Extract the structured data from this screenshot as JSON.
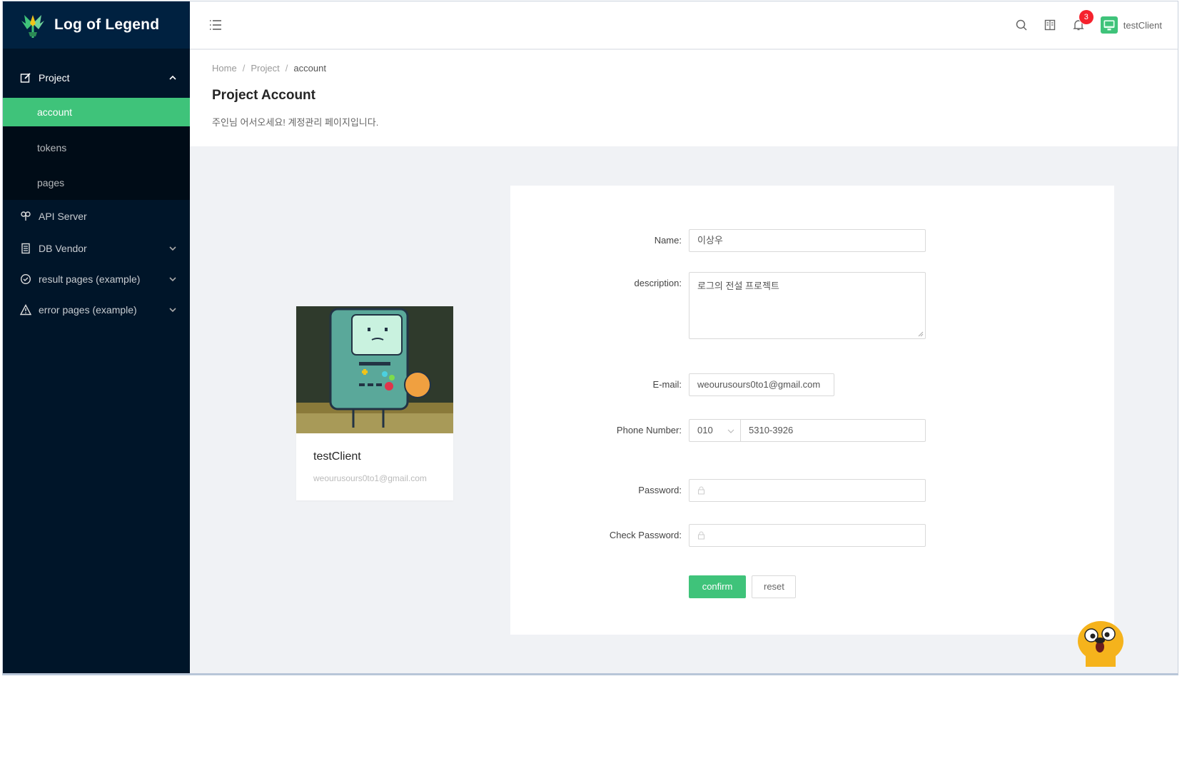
{
  "app": {
    "title": "Log of Legend",
    "accent_color": "#3fc37a",
    "sidebar_color": "#001529"
  },
  "sidebar": {
    "project": {
      "label": "Project",
      "icon": "edit-icon",
      "children": [
        {
          "label": "account",
          "active": true
        },
        {
          "label": "tokens"
        },
        {
          "label": "pages"
        }
      ]
    },
    "items": [
      {
        "label": "API Server",
        "icon": "api-icon"
      },
      {
        "label": "DB Vendor",
        "icon": "database-icon"
      },
      {
        "label": "result pages (example)",
        "icon": "check-circle-icon"
      },
      {
        "label": "error pages (example)",
        "icon": "warning-icon"
      }
    ]
  },
  "header": {
    "notification_count": "3",
    "username": "testClient"
  },
  "breadcrumb": {
    "home": "Home",
    "project": "Project",
    "current": "account",
    "separator": "/"
  },
  "page": {
    "title": "Project Account",
    "description": "주인님 어서오세요! 계정관리 페이지입니다."
  },
  "profile": {
    "name": "testClient",
    "email": "weourusours0to1@gmail.com"
  },
  "form": {
    "name": {
      "label": "Name",
      "value": "이상우"
    },
    "description": {
      "label": "description",
      "value": "로그의 전설 프로젝트"
    },
    "email": {
      "label": "E-mail",
      "value": "weourusours0to1@gmail.com"
    },
    "phone": {
      "label": "Phone Number",
      "prefix": "010",
      "value": "5310-3926"
    },
    "password": {
      "label": "Password",
      "value": ""
    },
    "check_password": {
      "label": "Check Password",
      "value": ""
    },
    "confirm_label": "confirm",
    "reset_label": "reset",
    "label_suffix": ":"
  }
}
